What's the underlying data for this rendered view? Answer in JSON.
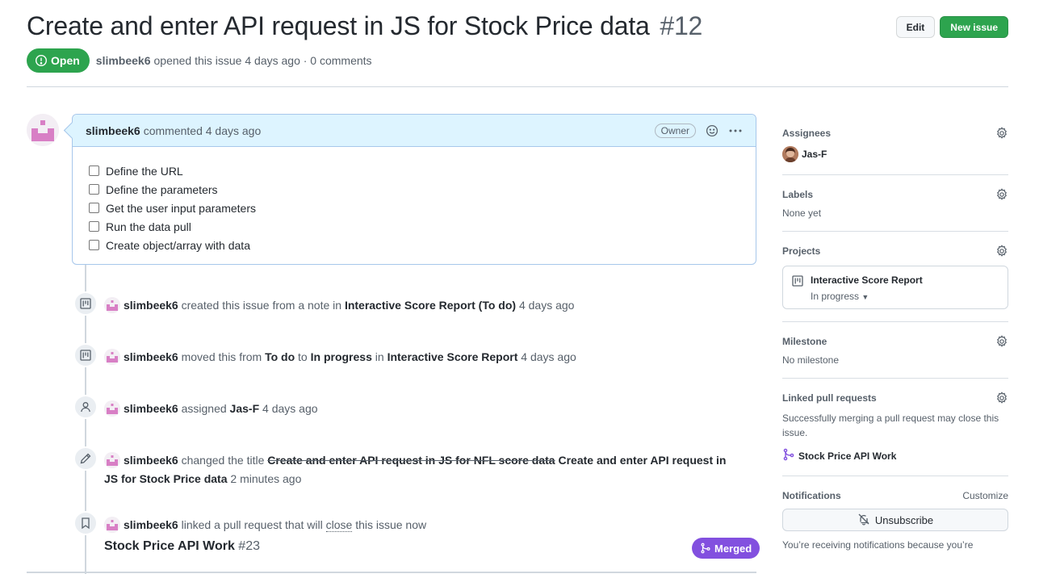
{
  "header": {
    "title": "Create and enter API request in JS for Stock Price data",
    "number": "#12",
    "edit_label": "Edit",
    "new_issue_label": "New issue",
    "state": "Open",
    "author": "slimbeek6",
    "meta_text": "opened this issue 4 days ago · 0 comments"
  },
  "comment": {
    "author": "slimbeek6",
    "action": "commented 4 days ago",
    "owner_badge": "Owner",
    "tasks": [
      "Define the URL",
      "Define the parameters",
      "Get the user input parameters",
      "Run the data pull",
      "Create object/array with data"
    ]
  },
  "timeline": {
    "e1": {
      "user": "slimbeek6",
      "t1": "created this issue from a note in",
      "project": "Interactive Score Report",
      "column": "(To do)",
      "time": "4 days ago"
    },
    "e2": {
      "user": "slimbeek6",
      "t1": "moved this from",
      "from": "To do",
      "t2": "to",
      "to": "In progress",
      "t3": "in",
      "project": "Interactive Score Report",
      "time": "4 days ago"
    },
    "e3": {
      "user": "slimbeek6",
      "t1": "assigned",
      "assignee": "Jas-F",
      "time": "4 days ago"
    },
    "e4": {
      "user": "slimbeek6",
      "t1": "changed the title",
      "old_title": "Create and enter API request in JS for NFL score data",
      "new_title": "Create and enter API request in JS for Stock Price data",
      "time": "2 minutes ago"
    },
    "e5": {
      "user": "slimbeek6",
      "t1": "linked a pull request that will",
      "t2": "close",
      "t3": "this issue now"
    },
    "pr": {
      "title": "Stock Price API Work",
      "number": "#23",
      "state": "Merged"
    }
  },
  "sidebar": {
    "assignees": {
      "label": "Assignees",
      "name": "Jas-F"
    },
    "labels": {
      "label": "Labels",
      "value": "None yet"
    },
    "projects": {
      "label": "Projects",
      "name": "Interactive Score Report",
      "status": "In progress"
    },
    "milestone": {
      "label": "Milestone",
      "value": "No milestone"
    },
    "linked": {
      "label": "Linked pull requests",
      "note": "Successfully merging a pull request may close this issue.",
      "pr": "Stock Price API Work"
    },
    "notifications": {
      "label": "Notifications",
      "customize": "Customize",
      "button": "Unsubscribe",
      "note": "You’re receiving notifications because you’re"
    }
  },
  "colors": {
    "open_green": "#2da44e",
    "merged_purple": "#8250df",
    "comment_blue": "#ddf4ff"
  },
  "icons": [
    "alert-circle-icon",
    "smiley-icon",
    "kebab-icon",
    "project-icon",
    "person-icon",
    "pencil-icon",
    "bookmark-icon",
    "merge-icon",
    "gear-icon",
    "bell-slash-icon",
    "caret-down-icon"
  ]
}
